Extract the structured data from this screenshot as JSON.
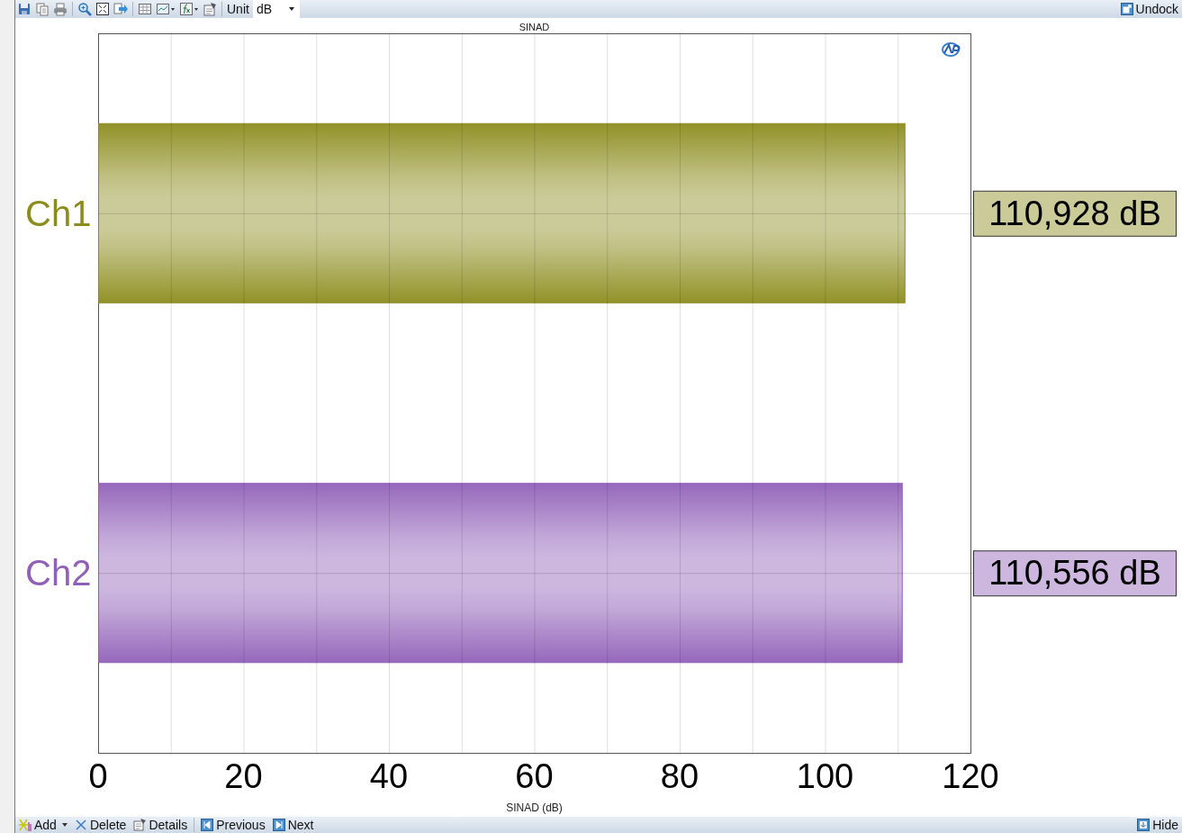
{
  "toolbar": {
    "unit_label": "Unit",
    "unit_value": "dB",
    "undock": "Undock"
  },
  "chart": {
    "chart_data": {
      "type": "bar",
      "orientation": "horizontal",
      "title": "SINAD",
      "xlabel": "SINAD (dB)",
      "grid": true,
      "series": [
        {
          "name": "Ch1",
          "color": "#8c8c1e",
          "values": [
            110.928
          ]
        },
        {
          "name": "Ch2",
          "color": "#9060b8",
          "values": [
            110.556
          ]
        }
      ],
      "xlim": [
        0,
        120
      ],
      "xticks": [
        0,
        20,
        40,
        60,
        80,
        100,
        120
      ],
      "value_labels": [
        "110,928 dB",
        "110,556 dB"
      ]
    }
  },
  "bottom_bar": {
    "add": "Add",
    "delete": "Delete",
    "details": "Details",
    "previous": "Previous",
    "next": "Next",
    "hide": "Hide"
  }
}
